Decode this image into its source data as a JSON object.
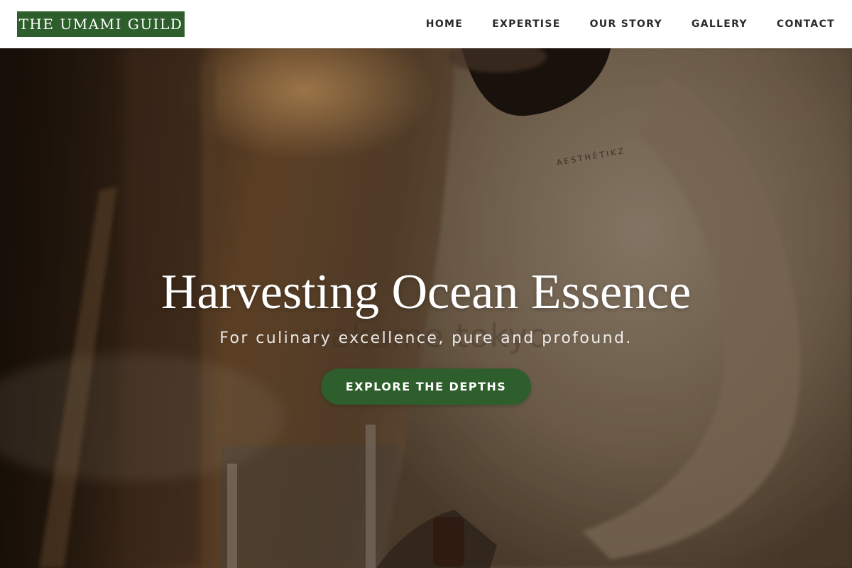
{
  "header": {
    "logo_text": "THE UMAMI GUILD",
    "nav": [
      {
        "label": "HOME"
      },
      {
        "label": "EXPERTISE"
      },
      {
        "label": "OUR STORY"
      },
      {
        "label": "GALLERY"
      },
      {
        "label": "CONTACT"
      }
    ]
  },
  "hero": {
    "title": "Harvesting Ocean Essence",
    "subtitle": "For culinary excellence, pure and profound.",
    "cta_label": "EXPLORE THE DEPTHS",
    "watermark_text": "wakame tokyo",
    "shirt_print": "AESTHÉTIKZ"
  },
  "colors": {
    "brand_green": "#2e5e2c",
    "header_bg": "#ffffff",
    "nav_text": "#2a2a2a"
  }
}
